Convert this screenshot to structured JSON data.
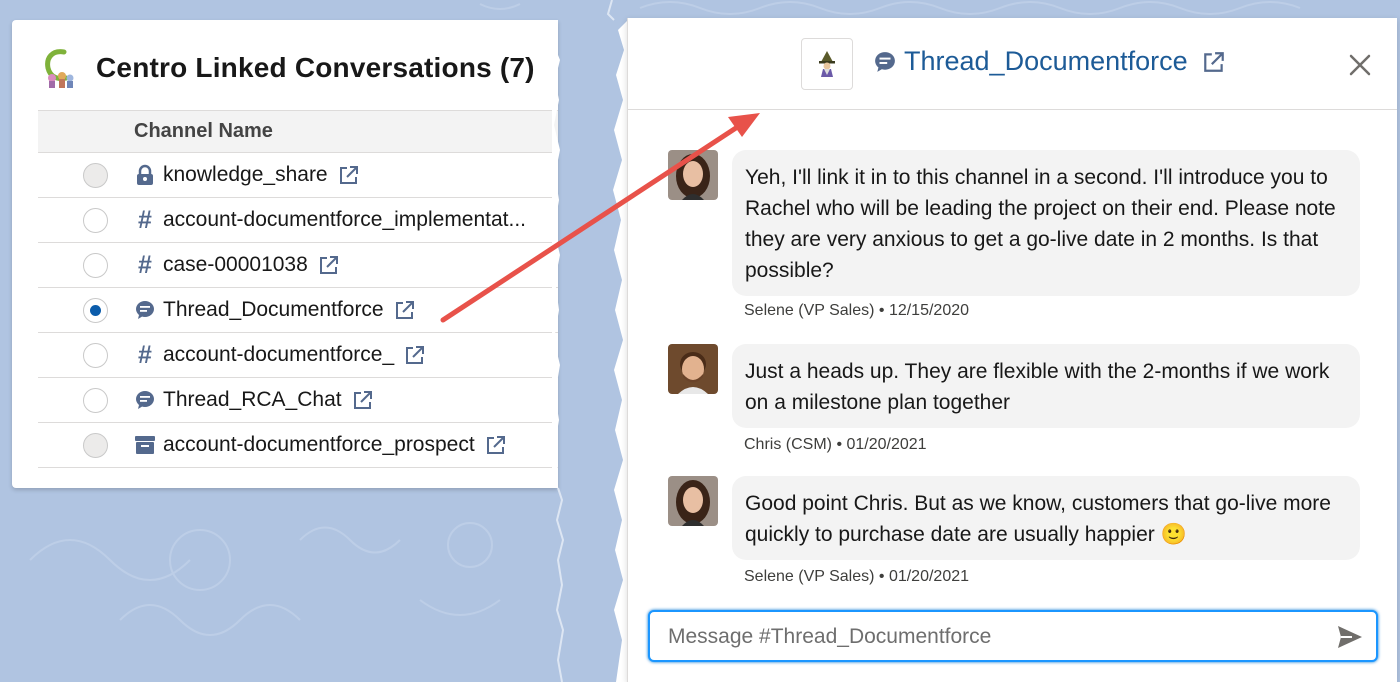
{
  "left_panel": {
    "title": "Centro Linked Conversations (7)",
    "column_header": "Channel Name",
    "rows": [
      {
        "icon": "lock-icon",
        "name": "knowledge_share",
        "selected": false,
        "disabled": true
      },
      {
        "icon": "hashtag-icon",
        "name": "account-documentforce_implementat...",
        "selected": false,
        "disabled": false
      },
      {
        "icon": "hashtag-icon",
        "name": "case-00001038",
        "selected": false,
        "disabled": false
      },
      {
        "icon": "chat-bubble-icon",
        "name": "Thread_Documentforce",
        "selected": true,
        "disabled": false
      },
      {
        "icon": "hashtag-icon",
        "name": "account-documentforce_",
        "selected": false,
        "disabled": false
      },
      {
        "icon": "chat-bubble-icon",
        "name": "Thread_RCA_Chat",
        "selected": false,
        "disabled": false
      },
      {
        "icon": "archive-icon",
        "name": "account-documentforce_prospect",
        "selected": false,
        "disabled": true
      }
    ]
  },
  "right_panel": {
    "thread_title": "Thread_Documentforce",
    "messages": [
      {
        "author": "Selene",
        "text": "Yeh, I'll link it in to this channel in a second. I'll introduce you to Rachel who will be leading the project on their end. Please note they are very anxious to get a go-live date in 2 months. Is that possible?",
        "meta": "Selene (VP Sales) • 12/15/2020"
      },
      {
        "author": "Chris",
        "text": "Just a heads up. They are flexible with the 2-months if we work on a milestone plan together",
        "meta": "Chris (CSM) • 01/20/2021"
      },
      {
        "author": "Selene",
        "text": "Good point Chris. But as we know, customers that go-live more quickly to purchase date are usually happier 🙂",
        "meta": "Selene (VP Sales) • 01/20/2021"
      }
    ],
    "composer": {
      "placeholder": "Message #Thread_Documentforce",
      "value": ""
    }
  },
  "colors": {
    "background": "#b0c4e1",
    "link_blue": "#1d5b97",
    "focus_blue": "#1b96ff",
    "radio_selected": "#0b5cab",
    "arrow": "#e8524a"
  }
}
